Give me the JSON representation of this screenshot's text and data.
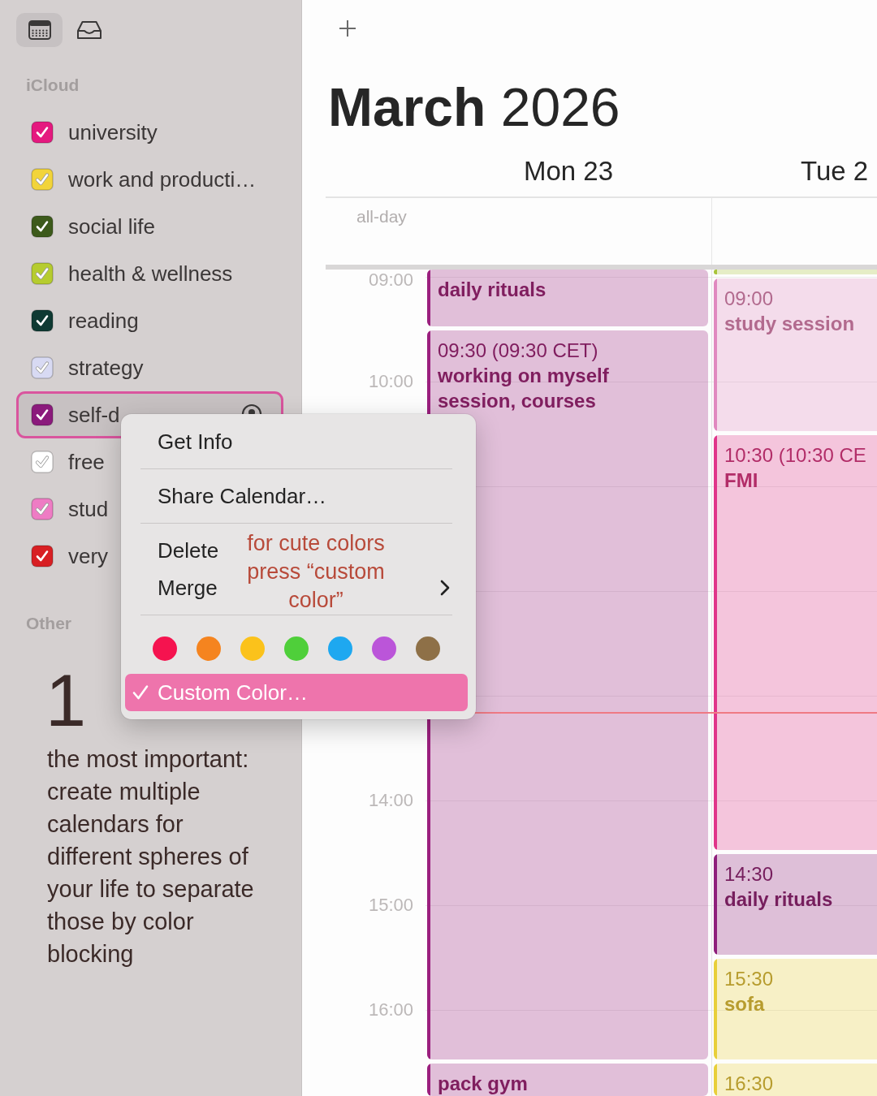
{
  "sidebar": {
    "toolbar": [
      {
        "kind": "calendar",
        "selected": true
      },
      {
        "kind": "inbox",
        "selected": false
      }
    ],
    "groups": [
      {
        "title": "iCloud",
        "calendars": [
          {
            "name": "university",
            "checked": true,
            "selected": false,
            "shared": false,
            "color": "#e5197f"
          },
          {
            "name": "work and producti…",
            "checked": true,
            "selected": false,
            "shared": false,
            "color": "#f2d43a"
          },
          {
            "name": "social life",
            "checked": true,
            "selected": false,
            "shared": false,
            "color": "#3d5a1b"
          },
          {
            "name": "health & wellness",
            "checked": true,
            "selected": false,
            "shared": false,
            "color": "#b6cc2f"
          },
          {
            "name": "reading",
            "checked": true,
            "selected": false,
            "shared": false,
            "color": "#0f3a33"
          },
          {
            "name": "strategy",
            "checked": true,
            "selected": false,
            "shared": false,
            "color": "#d8daf3"
          },
          {
            "name": "self-d",
            "checked": true,
            "selected": true,
            "shared": true,
            "color": "#8b1a7c"
          },
          {
            "name": "free",
            "checked": true,
            "selected": false,
            "shared": false,
            "color": "#ffffff"
          },
          {
            "name": "stud",
            "checked": true,
            "selected": false,
            "shared": false,
            "color": "#ee7cc4"
          },
          {
            "name": "very",
            "checked": true,
            "selected": false,
            "shared": false,
            "color": "#d81f23"
          }
        ]
      },
      {
        "title": "Other"
      }
    ],
    "tip": {
      "number": "1",
      "text": "the most important:\ncreate multiple\ncalendars for\ndifferent spheres of\nyour life to separate\nthose by color\nblocking"
    }
  },
  "calendar": {
    "title": "**March** 2026",
    "all_day_label": "all-day",
    "hours": [
      "09:00",
      "10:00",
      "14:00",
      "15:00",
      "16:00"
    ],
    "days": [
      {
        "label": "Mon 23",
        "events": [
          {
            "title": "daily rituals",
            "color": "#9b1f7e"
          },
          {
            "time": "09:30 (09:30 CET)",
            "title": "working on myself session, courses",
            "color": "#9b1f7e"
          },
          {
            "title": "pack gym",
            "color": "#9b1f7e"
          }
        ]
      },
      {
        "label": "Tue 2",
        "events": [
          {
            "color": "#a8c43a"
          },
          {
            "time": "09:00",
            "title": "study session",
            "color": "#e089bf"
          },
          {
            "time": "10:30 (10:30 CE",
            "title": "FMI",
            "color": "#e0358a"
          },
          {
            "time": "14:30",
            "title": "daily rituals",
            "color": "#8e1f7b"
          },
          {
            "time": "15:30",
            "title": "sofa",
            "color": "#e8cf3a"
          },
          {
            "time": "16:30",
            "color": "#e8cf3a"
          }
        ]
      }
    ]
  },
  "context_menu": {
    "sections": [
      {
        "items": [
          {
            "label": "Get Info",
            "selected": false,
            "checked": false,
            "submenu": false
          }
        ]
      },
      {
        "items": [
          {
            "label": "Share Calendar…",
            "selected": false,
            "checked": false,
            "submenu": false
          }
        ]
      },
      {
        "items": [
          {
            "label": "Delete",
            "selected": false,
            "checked": false,
            "submenu": false
          },
          {
            "label": "Merge",
            "selected": false,
            "checked": false,
            "submenu": true
          }
        ],
        "note": "for cute colors\npress “custom\ncolor”"
      },
      {
        "swatches": [
          {
            "color": "#f5134f"
          },
          {
            "color": "#f5841f"
          },
          {
            "color": "#fbc21b"
          },
          {
            "color": "#4fcf3a"
          },
          {
            "color": "#1ea8f0"
          },
          {
            "color": "#bb55d9"
          },
          {
            "color": "#8e7047"
          }
        ],
        "items": [
          {
            "label": "Custom Color…",
            "selected": true,
            "checked": true,
            "submenu": false
          }
        ]
      }
    ]
  }
}
